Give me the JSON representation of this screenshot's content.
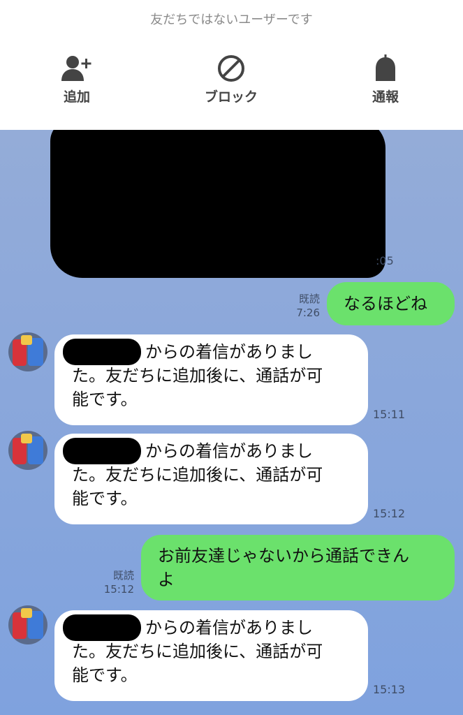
{
  "header": {
    "notice": "友だちではないユーザーです",
    "actions": [
      {
        "label": "追加",
        "icon": "add-friend-icon"
      },
      {
        "label": "ブロック",
        "icon": "block-icon"
      },
      {
        "label": "通報",
        "icon": "report-icon"
      }
    ]
  },
  "colors": {
    "chat_background": "#8aa7db",
    "sent_bubble": "#6be16c",
    "received_bubble": "#ffffff",
    "header_text": "#444444"
  },
  "messages": [
    {
      "type": "received",
      "redacted": true,
      "time_fragment": ":05"
    },
    {
      "type": "sent",
      "read_label": "既読",
      "time": "7:26",
      "text": "なるほどね"
    },
    {
      "type": "received",
      "line1": "からの着信がありまし",
      "line2": "た。友だちに追加後に、通話が可",
      "line3": "能です。",
      "time": "15:11"
    },
    {
      "type": "received",
      "line1": "からの着信がありまし",
      "line2": "た。友だちに追加後に、通話が可",
      "line3": "能です。",
      "time": "15:12"
    },
    {
      "type": "sent",
      "read_label": "既読",
      "time": "15:12",
      "line1": "お前友達じゃないから通話できん",
      "line2": "よ"
    },
    {
      "type": "received",
      "line1": "からの着信がありまし",
      "line2": "た。友だちに追加後に、通話が可",
      "line3": "能です。",
      "time": "15:13"
    }
  ]
}
